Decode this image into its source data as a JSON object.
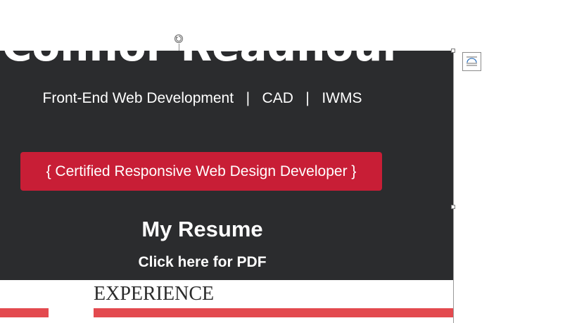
{
  "image": {
    "title": "Connor Readnour",
    "subtitle": "Front-End Web Development   |   CAD   |   IWMS",
    "certification": "{ Certified Responsive Web Design Developer }",
    "resume_heading": "My Resume",
    "pdf_link": "Click here for PDF",
    "section_heading": "EXPERIENCE"
  },
  "colors": {
    "hero_background": "#2b2c2e",
    "badge": "#c81e36",
    "accent_bar": "#e34a4f"
  },
  "icons": {
    "rotate": "rotate-handle-icon",
    "layout_options": "layout-options-icon"
  }
}
